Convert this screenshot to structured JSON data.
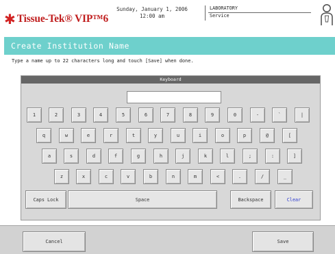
{
  "header": {
    "logo_star": "✱",
    "logo_text": "Tissue-Tek® VIP™6",
    "date": "Sunday, January 1, 2006",
    "time": "12:00 am",
    "context_primary": "LABORATORY",
    "context_secondary": "Service",
    "user_icon": "person-icon"
  },
  "title_bar": {
    "title": "Create Institution Name"
  },
  "instruction": "Type a name up to 22 characters long and touch [Save] when done.",
  "keyboard": {
    "title": "Keyboard",
    "input_value": "",
    "rows": [
      [
        "1",
        "2",
        "3",
        "4",
        "5",
        "6",
        "7",
        "8",
        "9",
        "0",
        "-",
        "`",
        "|"
      ],
      [
        "q",
        "w",
        "e",
        "r",
        "t",
        "y",
        "u",
        "i",
        "o",
        "p",
        "@",
        "["
      ],
      [
        "a",
        "s",
        "d",
        "f",
        "g",
        "h",
        "j",
        "k",
        "l",
        ";",
        ":",
        "]"
      ],
      [
        "z",
        "x",
        "c",
        "v",
        "b",
        "n",
        "m",
        "<",
        ".",
        "/",
        "_"
      ]
    ],
    "caps_lock": "Caps Lock",
    "space": "Space",
    "backspace": "Backspace",
    "clear": "Clear"
  },
  "buttons": {
    "cancel": "Cancel",
    "save": "Save"
  },
  "colors": {
    "title_bar": "#6ed0cc",
    "logo_red": "#c01e1e",
    "clear_text": "#2c3ad0",
    "keyboard_header": "#666666"
  }
}
